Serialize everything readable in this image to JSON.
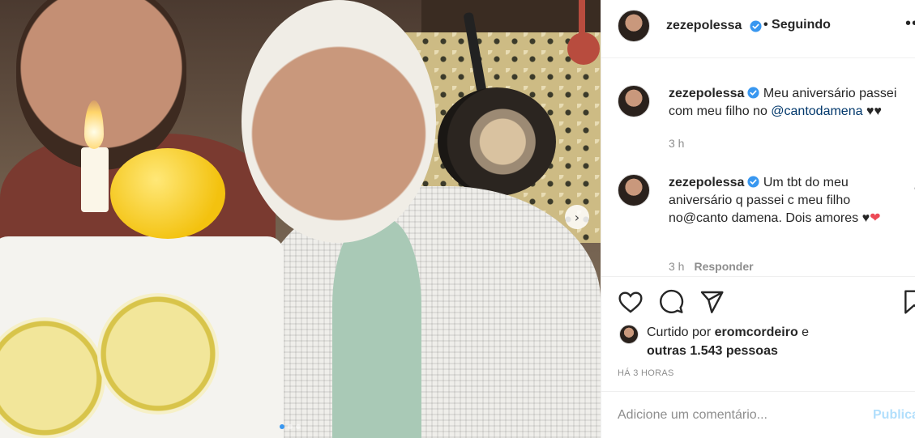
{
  "post": {
    "photo_description_icon": "photo",
    "carousel_dots": 3,
    "carousel_active_index": 0
  },
  "header": {
    "username": "zezepolessa",
    "follow_state": "• Seguindo",
    "more_icon": "•••"
  },
  "comments": [
    {
      "username": "zezepolessa",
      "text": "Meu aniversário passei com meu filho no ",
      "mention": "@cantodamena",
      "suffix": " ♥♥",
      "time": "3 h"
    },
    {
      "username": "zezepolessa",
      "text": "Um tbt do meu aniversário q passei c meu filho no@canto damena. Dois amores ♥",
      "suffix": "❤",
      "time": "3 h",
      "reply_label": "Responder"
    }
  ],
  "likes": {
    "prefix": "Curtido por ",
    "user": "eromcordeiro",
    "mid": " e",
    "others": "outras 1.543 pessoas"
  },
  "timestamp": "HÁ 3 HORAS",
  "add_comment": {
    "placeholder": "Adicione um comentário...",
    "publish_label": "Publicar"
  },
  "colors": {
    "verified": "#3897f0",
    "mention": "#00376b",
    "publish_disabled": "#b2dffc",
    "heart": "#ed4956"
  }
}
